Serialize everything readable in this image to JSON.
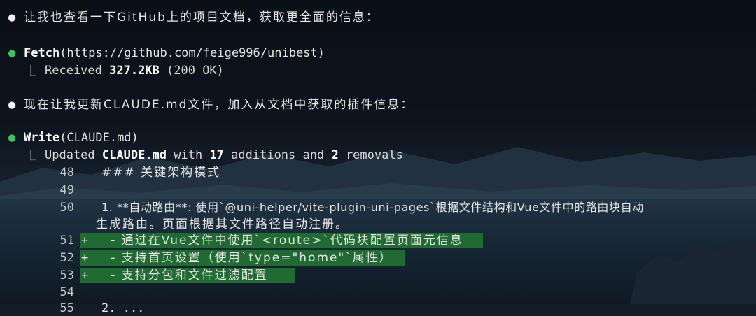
{
  "messages": {
    "intro": "让我也查看一下GitHub上的项目文档，获取更全面的信息：",
    "fetch_tool": "Fetch",
    "fetch_args": "(https://github.com/feige996/unibest)",
    "fetch_result_prefix": "Received ",
    "fetch_result_size": "327.2KB",
    "fetch_result_suffix": " (200 OK)",
    "update_note": "现在让我更新CLAUDE.md文件，加入从文档中获取的插件信息：",
    "write_tool": "Write",
    "write_args": "(CLAUDE.md)",
    "write_result": {
      "w1": "Updated ",
      "file": "CLAUDE.md",
      "w2": " with ",
      "additions": "17",
      "w3": " additions and ",
      "removals": "2",
      "w4": " removals"
    }
  },
  "diff": [
    {
      "num": "48",
      "marker": "",
      "text": "### 关键架构模式"
    },
    {
      "num": "49",
      "marker": "",
      "text": ""
    },
    {
      "num": "50",
      "marker": "",
      "text": "1. **自动路由**: 使用`@uni-helper/vite-plugin-uni-pages`根据文件结构和Vue文件中的路由块自动"
    },
    {
      "num": "",
      "marker": "",
      "text": "生成路由。页面根据其文件路径自动注册。"
    },
    {
      "num": "51",
      "marker": "+",
      "text": "   - 通过在Vue文件中使用`<route>`代码块配置页面元信息"
    },
    {
      "num": "52",
      "marker": "+",
      "text": "   - 支持首页设置（使用`type=\"home\"`属性）"
    },
    {
      "num": "53",
      "marker": "+",
      "text": "   - 支持分包和文件过滤配置"
    },
    {
      "num": "54",
      "marker": "",
      "text": ""
    },
    {
      "num": "55",
      "marker": "",
      "text": "2. ..."
    }
  ],
  "icons": {
    "bullet_info": "white-dot-icon",
    "bullet_tool": "green-dot-icon",
    "result_branch": "tree-branch-icon"
  },
  "colors": {
    "bullet_tool": "#3cc35b",
    "added_line_bg": "#1f6b32"
  }
}
